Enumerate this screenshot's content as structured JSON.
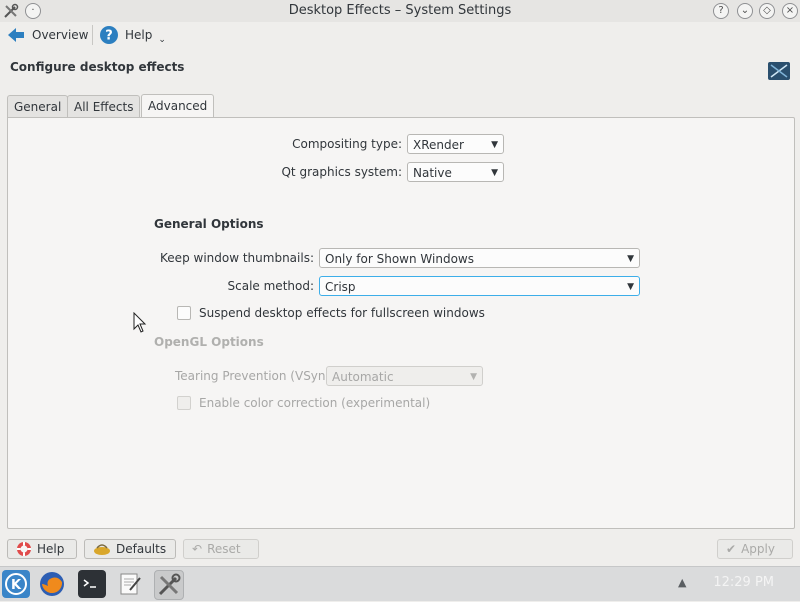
{
  "window": {
    "title": "Desktop Effects – System Settings"
  },
  "toolbar": {
    "overview_label": "Overview",
    "help_label": "Help"
  },
  "heading": "Configure desktop effects",
  "tabs": [
    {
      "label": "General",
      "active": false
    },
    {
      "label": "All Effects",
      "active": false
    },
    {
      "label": "Advanced",
      "active": true
    }
  ],
  "advanced": {
    "compositing_type_label": "Compositing type:",
    "compositing_type_value": "XRender",
    "qt_graphics_label": "Qt graphics system:",
    "qt_graphics_value": "Native",
    "general_options_title": "General Options",
    "keep_thumbnails_label": "Keep window thumbnails:",
    "keep_thumbnails_value": "Only for Shown Windows",
    "scale_method_label": "Scale method:",
    "scale_method_value": "Crisp",
    "suspend_label": "Suspend desktop effects for fullscreen windows",
    "suspend_checked": false,
    "opengl_title": "OpenGL Options",
    "tearing_label": "Tearing Prevention (VSync)",
    "tearing_value": "Automatic",
    "color_correction_label": "Enable color correction (experimental)",
    "color_correction_checked": false
  },
  "buttons": {
    "help": "Help",
    "defaults": "Defaults",
    "reset": "Reset",
    "apply": "Apply"
  },
  "taskbar": {
    "clock": "12:29 PM"
  },
  "colors": {
    "focus": "#3daee9",
    "kde_blue": "#2c7fc0"
  }
}
